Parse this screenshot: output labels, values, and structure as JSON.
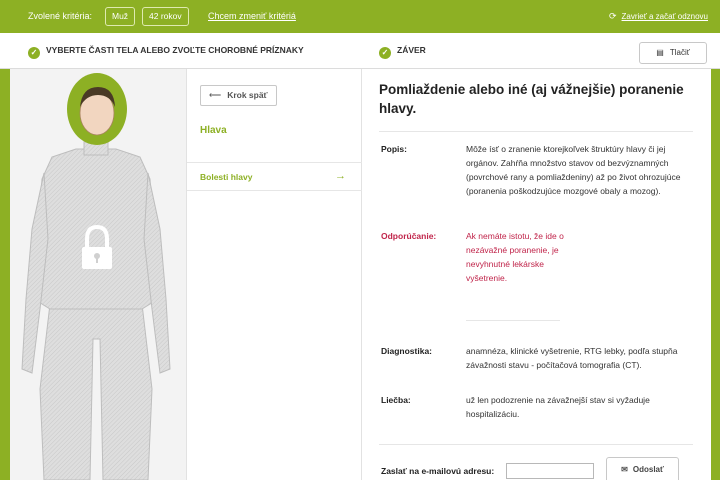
{
  "criteria": {
    "label": "Zvolené kritéria:",
    "sex": "Muž",
    "age": "42 rokov",
    "change_link": "Chcem zmeniť kritériá",
    "restart_icon": "refresh-icon",
    "restart_link": "Zavrieť a začať odznovu"
  },
  "steps": {
    "step1": "VYBERTE ČASTI TELA ALEBO ZVOĽTE CHOROBNÉ PRÍZNAKY",
    "step2": "ZÁVER",
    "check_icon": "check-icon",
    "print_label": "Tlačiť",
    "print_icon": "printer-icon"
  },
  "nav": {
    "back_label": "Krok späť",
    "region": "Hlava",
    "symptom": "Bolesti hlavy",
    "arrow_icon": "arrow-right-icon"
  },
  "figure": {
    "lock_icon": "lock-icon",
    "highlight_color": "#8db024"
  },
  "diagnosis": {
    "title": "Pomliaždenie alebo iné (aj vážnejšie) poranenie hlavy.",
    "description_label": "Popis:",
    "description_text": "Môže ísť o zranenie ktorejkoľvek štruktúry hlavy či jej orgánov. Zahŕňa množstvo stavov od bezvýznamných (povrchové rany a pomliaždeniny) až po život ohrozujúce (poranenia poškodzujúce mozgové obaly a mozog).",
    "recommendation_label": "Odporúčanie:",
    "recommendation_text": "Ak nemáte istotu, že ide o nezávažné poranenie, je nevyhnutné lekárske vyšetrenie.",
    "diagnostics_label": "Diagnostika:",
    "diagnostics_text": "anamnéza, klinické vyšetrenie, RTG lebky, podľa stupňa závažnosti stavu - počítačová tomografia (CT).",
    "treatment_label": "Liečba:",
    "treatment_text": "už len podozrenie na závažnejší stav si vyžaduje hospitalizáciu."
  },
  "email": {
    "label": "Zaslať na e-mailovú adresu:",
    "value": "",
    "send_label": "Odoslať",
    "send_icon": "envelope-icon"
  },
  "colors": {
    "accent": "#8db024",
    "warning": "#c0244a"
  }
}
